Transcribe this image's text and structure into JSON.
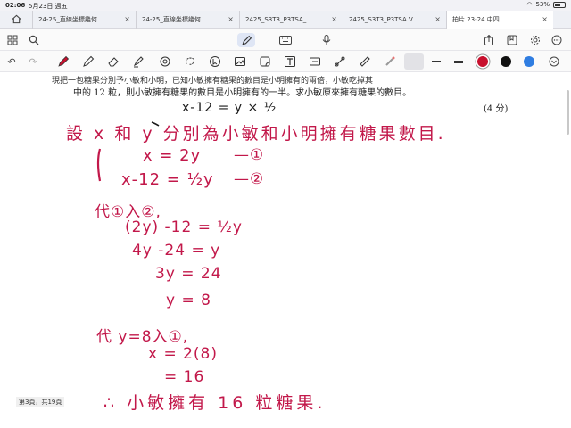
{
  "status": {
    "time": "02:06",
    "date": "5月23日 週五",
    "battery": "53%"
  },
  "tabs": [
    {
      "label": "24-25_直線坐標幾何..."
    },
    {
      "label": "24-25_直線坐標幾何..."
    },
    {
      "label": "2425_S3T3_P3TSA_..."
    },
    {
      "label": "2425_S3T3_P3TSA V..."
    },
    {
      "label": "拍片 23-24 中四..."
    }
  ],
  "colors": {
    "accent": "#c2184a",
    "red": "#c8102e",
    "black": "#111111",
    "blue": "#2f7de1"
  },
  "icons": {
    "home": "home-icon",
    "grid": "grid-icon",
    "search": "search-icon",
    "pen_mode": "pen-mode-icon",
    "keyboard": "keyboard-icon",
    "mic": "mic-icon",
    "share": "share-icon",
    "bookmark": "bookmark-icon",
    "settings": "gear-icon",
    "more": "more-icon"
  },
  "doc": {
    "problem_line1": "現把一包糖果分別予小敏和小明，已知小敏擁有糖果的數目是小明擁有的兩倍，小敏吃掉其",
    "problem_line2": "中的 12 粒，則小敏擁有糖果的數目是小明擁有的一半。求小敏原來擁有糖果的數目。",
    "marks": "(4 分)",
    "hand_top": "x-12   =  y  × ½",
    "let": "設 x 和 y 分別為小敏和小明擁有糖果數目.",
    "eq1": "x = 2y",
    "eq1_tag": "—①",
    "eq2": "x-12 = ½y",
    "eq2_tag": "—②",
    "sub1": "代①入②,",
    "s1": "(2y) -12 = ½y",
    "s2": "4y -24 = y",
    "s3": "3y = 24",
    "s4": "y = 8",
    "sub2": "代 y=8入①,",
    "s5": "x = 2(8)",
    "s6": "= 16",
    "conclusion": "∴ 小敏擁有 16 粒糖果.",
    "page_info": "第3頁，共19頁"
  }
}
